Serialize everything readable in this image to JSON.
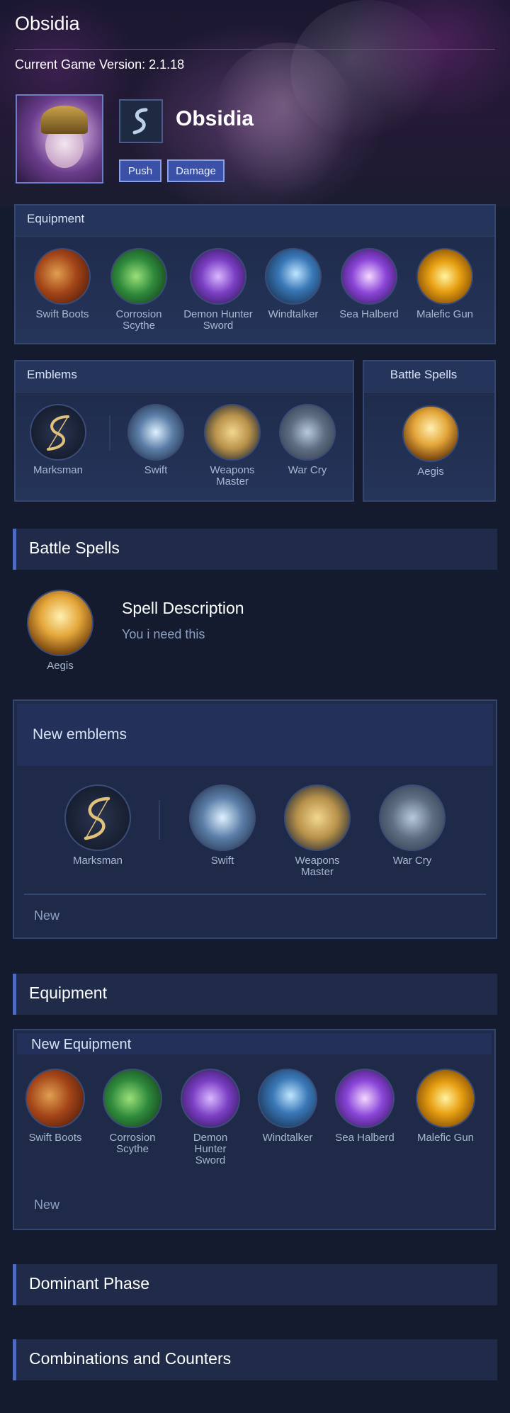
{
  "page": {
    "title": "Obsidia",
    "version_text": "Current Game Version: 2.1.18"
  },
  "hero": {
    "name": "Obsidia",
    "role_icon": "marksman-emblem-icon",
    "tags": [
      "Push",
      "Damage"
    ]
  },
  "equipment_card": {
    "title": "Equipment",
    "items": [
      {
        "label": "Swift Boots",
        "icon": "swift-boots-icon"
      },
      {
        "label": "Corrosion Scythe",
        "icon": "corrosion-scythe-icon"
      },
      {
        "label": "Demon Hunter Sword",
        "icon": "demon-hunter-sword-icon"
      },
      {
        "label": "Windtalker",
        "icon": "windtalker-icon"
      },
      {
        "label": "Sea Halberd",
        "icon": "sea-halberd-icon"
      },
      {
        "label": "Malefic Gun",
        "icon": "malefic-gun-icon"
      }
    ]
  },
  "emblems_card": {
    "title": "Emblems",
    "main": {
      "label": "Marksman",
      "icon": "marksman-emblem-icon"
    },
    "talents": [
      {
        "label": "Swift",
        "icon": "swift-talent-icon"
      },
      {
        "label": "Weapons Master",
        "icon": "weapons-master-talent-icon"
      },
      {
        "label": "War Cry",
        "icon": "war-cry-talent-icon"
      }
    ]
  },
  "spells_card": {
    "title": "Battle Spells",
    "spell": {
      "label": "Aegis",
      "icon": "aegis-spell-icon"
    }
  },
  "battle_spells_section": {
    "heading": "Battle Spells",
    "spell_label": "Aegis",
    "description_title": "Spell Description",
    "description_text": "You i need this"
  },
  "new_emblems": {
    "title": "New emblems",
    "main": {
      "label": "Marksman"
    },
    "talents": [
      {
        "label": "Swift"
      },
      {
        "label": "Weapons Master"
      },
      {
        "label": "War Cry"
      }
    ],
    "footer": "New"
  },
  "equipment_section": {
    "heading": "Equipment"
  },
  "new_equipment": {
    "title": "New Equipment",
    "items": [
      {
        "label": "Swift Boots"
      },
      {
        "label": "Corrosion Scythe"
      },
      {
        "label": "Demon Hunter Sword"
      },
      {
        "label": "Windtalker"
      },
      {
        "label": "Sea Halberd"
      },
      {
        "label": "Malefic Gun"
      }
    ],
    "footer": "New"
  },
  "sections": {
    "dominant_phase": "Dominant Phase",
    "combinations": "Combinations and Counters"
  },
  "colors": {
    "background": "#141b2e",
    "card": "#1d2947",
    "accent": "#4f6bbf",
    "tag_fill": "#3b51a8",
    "muted_text": "#a9b7d1"
  }
}
